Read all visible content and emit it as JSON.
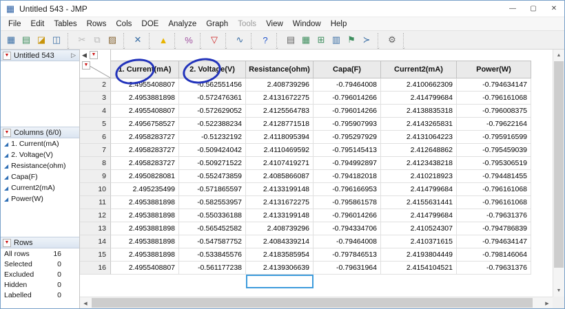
{
  "window": {
    "title": "Untitled 543 - JMP"
  },
  "icons": {
    "app": "▦",
    "minimize": "—",
    "maximize": "▢",
    "close": "✕",
    "red_triangle": "▼",
    "collapse_left": "◀",
    "expand_right": "▷",
    "continuous_column": "◢",
    "scroll_up": "▲",
    "scroll_down": "▼",
    "scroll_left": "◀",
    "scroll_right": "▶"
  },
  "menu": {
    "items": [
      {
        "label": "File"
      },
      {
        "label": "Edit"
      },
      {
        "label": "Tables"
      },
      {
        "label": "Rows"
      },
      {
        "label": "Cols"
      },
      {
        "label": "DOE"
      },
      {
        "label": "Analyze"
      },
      {
        "label": "Graph"
      },
      {
        "label": "Tools",
        "disabled": true
      },
      {
        "label": "View"
      },
      {
        "label": "Window"
      },
      {
        "label": "Help"
      }
    ]
  },
  "toolbar": {
    "icons": [
      {
        "name": "new-data-table-icon",
        "glyph": "▦",
        "color": "#3a6ea5"
      },
      {
        "name": "new-journal-icon",
        "glyph": "▤",
        "color": "#3f8f5f"
      },
      {
        "name": "open-icon",
        "glyph": "◪",
        "color": "#c8940a"
      },
      {
        "name": "save-icon",
        "glyph": "◫",
        "color": "#3a6ea5"
      },
      {
        "sep": true
      },
      {
        "name": "cut-icon",
        "glyph": "✂",
        "color": "#777777",
        "disabled": true
      },
      {
        "name": "copy-icon",
        "glyph": "⧉",
        "color": "#777777",
        "disabled": true
      },
      {
        "name": "paste-icon",
        "glyph": "▨",
        "color": "#8a6a3a"
      },
      {
        "sep": true
      },
      {
        "name": "clear-icon",
        "glyph": "✕",
        "color": "#3a6ea5"
      },
      {
        "sep": true
      },
      {
        "name": "warning-icon",
        "glyph": "▲",
        "color": "#e8b400"
      },
      {
        "sep": true
      },
      {
        "name": "percent-format-icon",
        "glyph": "%",
        "color": "#a050a0"
      },
      {
        "sep": true
      },
      {
        "name": "data-filter-icon",
        "glyph": "▽",
        "color": "#cc2222"
      },
      {
        "sep": true
      },
      {
        "name": "graph-builder-icon",
        "glyph": "∿",
        "color": "#3a6ea5"
      },
      {
        "sep": true
      },
      {
        "name": "help-icon",
        "glyph": "?",
        "color": "#2255cc"
      },
      {
        "sep": true
      },
      {
        "name": "print-icon",
        "glyph": "▤",
        "color": "#666666"
      },
      {
        "name": "report-table-icon",
        "glyph": "▦",
        "color": "#3f8f5f"
      },
      {
        "name": "layout-icon",
        "glyph": "⊞",
        "color": "#3f8f5f"
      },
      {
        "name": "columns-view-icon",
        "glyph": "▥",
        "color": "#3a6ea5"
      },
      {
        "name": "flag-icon",
        "glyph": "⚑",
        "color": "#3f8f5f"
      },
      {
        "name": "marker-icon",
        "glyph": "≻",
        "color": "#3a6ea5"
      },
      {
        "sep": true
      },
      {
        "name": "tools-icon",
        "glyph": "⚙",
        "color": "#666666"
      },
      {
        "sep": true
      }
    ]
  },
  "sidebar": {
    "table_panel": {
      "title": "Untitled 543"
    },
    "columns_panel": {
      "title": "Columns (6/0)",
      "items": [
        "1. Current(mA)",
        "2. Voltage(V)",
        "Resistance(ohm)",
        "Capa(F)",
        "Current2(mA)",
        "Power(W)"
      ]
    },
    "rows_panel": {
      "title": "Rows",
      "stats": [
        {
          "label": "All rows",
          "value": "16"
        },
        {
          "label": "Selected",
          "value": "0"
        },
        {
          "label": "Excluded",
          "value": "0"
        },
        {
          "label": "Hidden",
          "value": "0"
        },
        {
          "label": "Labelled",
          "value": "0"
        }
      ]
    }
  },
  "table": {
    "columns": [
      "1. Current(mA)",
      "2. Voltage(V)",
      "Resistance(ohm)",
      "Capa(F)",
      "Current2(mA)",
      "Power(W)"
    ],
    "rows": [
      {
        "n": "2",
        "cells": [
          "2.4955408807",
          "-0.562551456",
          "2.408739296",
          "-0.79464008",
          "2.4100662309",
          "-0.794634147"
        ]
      },
      {
        "n": "3",
        "cells": [
          "2.4953881898",
          "-0.572476361",
          "2.4131672275",
          "-0.796014266",
          "2.414799684",
          "-0.796161068"
        ]
      },
      {
        "n": "4",
        "cells": [
          "2.4955408807",
          "-0.572629052",
          "2.4125564783",
          "-0.796014266",
          "2.4138835318",
          "-0.796008375"
        ]
      },
      {
        "n": "5",
        "cells": [
          "2.4956758527",
          "-0.522388234",
          "2.4128771518",
          "-0.795907993",
          "2.4143265831",
          "-0.79622164"
        ]
      },
      {
        "n": "6",
        "cells": [
          "2.4958283727",
          "-0.51232192",
          "2.4118095394",
          "-0.795297929",
          "2.4131064223",
          "-0.795916599"
        ]
      },
      {
        "n": "7",
        "cells": [
          "2.4958283727",
          "-0.509424042",
          "2.4110469592",
          "-0.795145413",
          "2.412648862",
          "-0.795459039"
        ]
      },
      {
        "n": "8",
        "cells": [
          "2.4958283727",
          "-0.509271522",
          "2.4107419271",
          "-0.794992897",
          "2.4123438218",
          "-0.795306519"
        ]
      },
      {
        "n": "9",
        "cells": [
          "2.4950828081",
          "-0.552473859",
          "2.4085866087",
          "-0.794182018",
          "2.410218923",
          "-0.794481455"
        ]
      },
      {
        "n": "10",
        "cells": [
          "2.495235499",
          "-0.571865597",
          "2.4133199148",
          "-0.796166953",
          "2.414799684",
          "-0.796161068"
        ]
      },
      {
        "n": "11",
        "cells": [
          "2.4953881898",
          "-0.582553957",
          "2.4131672275",
          "-0.795861578",
          "2.4155631441",
          "-0.796161068"
        ]
      },
      {
        "n": "12",
        "cells": [
          "2.4953881898",
          "-0.550336188",
          "2.4133199148",
          "-0.796014266",
          "2.414799684",
          "-0.79631376"
        ]
      },
      {
        "n": "13",
        "cells": [
          "2.4953881898",
          "-0.565452582",
          "2.408739296",
          "-0.794334706",
          "2.410524307",
          "-0.794786839"
        ]
      },
      {
        "n": "14",
        "cells": [
          "2.4953881898",
          "-0.547587752",
          "2.4084339214",
          "-0.79464008",
          "2.410371615",
          "-0.794634147"
        ]
      },
      {
        "n": "15",
        "cells": [
          "2.4953881898",
          "-0.533845576",
          "2.4183585954",
          "-0.797846513",
          "2.4193804449",
          "-0.798146064"
        ]
      },
      {
        "n": "16",
        "cells": [
          "2.4955408807",
          "-0.561177238",
          "2.4139306639",
          "-0.79631964",
          "2.4154104521",
          "-0.79631376"
        ]
      }
    ],
    "selection": {
      "column": "Resistance(ohm)",
      "after_row": "16"
    }
  },
  "annotations": [
    {
      "type": "ellipse",
      "around": "1.",
      "color": "#2233bb"
    },
    {
      "type": "ellipse",
      "around": "2.",
      "color": "#2233bb"
    }
  ]
}
